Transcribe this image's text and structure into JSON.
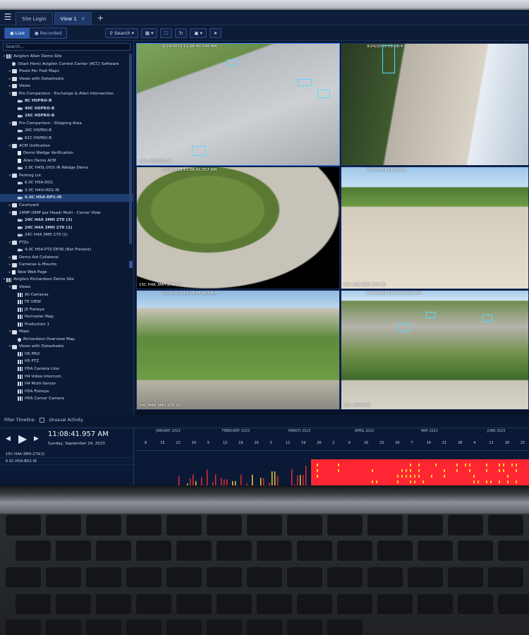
{
  "tabs": [
    {
      "label": "Site Login"
    },
    {
      "label": "View 1",
      "active": true
    }
  ],
  "toolbar": {
    "live_label": "Live",
    "recorded_label": "Recorded",
    "search_label": "Search"
  },
  "sidebar": {
    "search_placeholder": "Search...",
    "items": [
      {
        "label": "Avigilon Allen Demo Site",
        "indent": 0,
        "icon": "grid",
        "twisty": "▾"
      },
      {
        "label": "(Start Here) Avigilon Control Center (ACC) Software",
        "indent": 1,
        "icon": "pin"
      },
      {
        "label": "Pixels Per Foot Maps",
        "indent": 1,
        "icon": "folder",
        "twisty": "▸"
      },
      {
        "label": "Views with Datasheets",
        "indent": 1,
        "icon": "folder",
        "twisty": "▸"
      },
      {
        "label": "Views",
        "indent": 1,
        "icon": "folder",
        "twisty": "▸"
      },
      {
        "label": "Pro Comparison - Exchange & Allen Intersection",
        "indent": 1,
        "icon": "folder",
        "twisty": "▾"
      },
      {
        "label": "8C H5PRO-B",
        "indent": 2,
        "icon": "cam",
        "bold": true
      },
      {
        "label": "40C H5PRO-B",
        "indent": 2,
        "icon": "cam",
        "bold": true
      },
      {
        "label": "16C H5PRO-B",
        "indent": 2,
        "icon": "cam",
        "bold": true
      },
      {
        "label": "Pro Comparison - Shipping Area",
        "indent": 1,
        "icon": "folder",
        "twisty": "▾"
      },
      {
        "label": "26C H5PRO-B",
        "indent": 2,
        "icon": "cam"
      },
      {
        "label": "61C H5PRO-B",
        "indent": 2,
        "icon": "cam"
      },
      {
        "label": "ACM Unification",
        "indent": 1,
        "icon": "folder",
        "twisty": "▾"
      },
      {
        "label": "Demo Wedge Verification",
        "indent": 2,
        "icon": "page"
      },
      {
        "label": "Allen Demo ACM",
        "indent": 2,
        "icon": "page"
      },
      {
        "label": "2.0C H4SL-DO1-IR Wedge Demo",
        "indent": 2,
        "icon": "cam"
      },
      {
        "label": "Parking Lot",
        "indent": 1,
        "icon": "folder",
        "twisty": "▾"
      },
      {
        "label": "6.0C H5A-DO1",
        "indent": 2,
        "icon": "cam"
      },
      {
        "label": "3.0C H4VI-RD1-IR",
        "indent": 2,
        "icon": "cam"
      },
      {
        "label": "6.0C H5A-DP1-IR",
        "indent": 2,
        "icon": "cam",
        "bold": true,
        "selected": true
      },
      {
        "label": "Courtyard",
        "indent": 1,
        "icon": "folder",
        "twisty": "▸"
      },
      {
        "label": "24MP (6MP per Head) Multi - Corner View",
        "indent": 1,
        "icon": "folder",
        "twisty": "▾"
      },
      {
        "label": "24C H4A 3MH 270 (3)",
        "indent": 2,
        "icon": "cam",
        "bold": true
      },
      {
        "label": "24C H4A 3MH 270 (1)",
        "indent": 2,
        "icon": "cam",
        "bold": true
      },
      {
        "label": "24C H4A 3MH 270 (2)",
        "indent": 2,
        "icon": "cam"
      },
      {
        "label": "PTZs",
        "indent": 1,
        "icon": "folder",
        "twisty": "▾"
      },
      {
        "label": "4.0C H5A-PTZ-DP36 (Not Present)",
        "indent": 2,
        "icon": "cam"
      },
      {
        "label": "Demo Aid Collateral",
        "indent": 1,
        "icon": "folder",
        "twisty": "▸"
      },
      {
        "label": "Cameras & Mounts",
        "indent": 1,
        "icon": "folder",
        "twisty": "▸"
      },
      {
        "label": "New Web Page",
        "indent": 1,
        "icon": "page",
        "twisty": "▸"
      },
      {
        "label": "Avigilon Richardson Demo Site",
        "indent": 0,
        "icon": "grid",
        "twisty": "▾"
      },
      {
        "label": "Views",
        "indent": 1,
        "icon": "folder",
        "twisty": "▾"
      },
      {
        "label": "All Cameras",
        "indent": 2,
        "icon": "grid"
      },
      {
        "label": "FE VIEW",
        "indent": 2,
        "icon": "grid"
      },
      {
        "label": "J5 Fisheye",
        "indent": 2,
        "icon": "grid"
      },
      {
        "label": "Perimeter Map",
        "indent": 2,
        "icon": "grid"
      },
      {
        "label": "Production 1",
        "indent": 2,
        "icon": "grid"
      },
      {
        "label": "Maps",
        "indent": 1,
        "icon": "folder",
        "twisty": "▾"
      },
      {
        "label": "Richardson Overview Map",
        "indent": 2,
        "icon": "pin"
      },
      {
        "label": "Views with Datasheets",
        "indent": 1,
        "icon": "folder",
        "twisty": "▾"
      },
      {
        "label": "H5 PRO",
        "indent": 2,
        "icon": "grid"
      },
      {
        "label": "H5 PTZ",
        "indent": 2,
        "icon": "grid"
      },
      {
        "label": "H5A Camera Line",
        "indent": 2,
        "icon": "grid"
      },
      {
        "label": "H4 Video Intercom",
        "indent": 2,
        "icon": "grid"
      },
      {
        "label": "H4 Multi-Sensor",
        "indent": 2,
        "icon": "grid"
      },
      {
        "label": "H5A Fisheye",
        "indent": 2,
        "icon": "grid"
      },
      {
        "label": "H5A Corner Camera",
        "indent": 2,
        "icon": "grid"
      }
    ]
  },
  "tiles": [
    {
      "timestamp": "9/24/2023 11:08:40.348 AM",
      "label": "6.0C H5A-DP1-IR",
      "scene": "parking"
    },
    {
      "timestamp": "9/24/2023 11:08:4",
      "label": "",
      "scene": "sidewalk"
    },
    {
      "timestamp": "9/24/2023 11:08:41.357 AM",
      "label": "15C H4A 3MH 270 (1)",
      "scene": "grass"
    },
    {
      "timestamp": "9/24/2023 11:08:40.",
      "label": "24C H4A 3MH 270 (2)",
      "scene": "lot"
    },
    {
      "timestamp": "9/24/2023 11:06:04.063 AM",
      "label": "24C H4A 3MH 270 (3)",
      "scene": "building"
    },
    {
      "timestamp": "9/24/2023 11:08:42.323 AM",
      "label": "15C H5PRO-B",
      "scene": "road"
    }
  ],
  "filter": {
    "title": "Filter Timeline:",
    "option": "Unusual Activity"
  },
  "timeline": {
    "clock": "11:08:41.957 AM",
    "date": "Sunday, September 24, 2023",
    "rows": [
      "15C-H4A-3MH-270(2)",
      "6.0C-H5A-BO1-IR"
    ],
    "months": [
      "JANUARY 2023",
      "FEBRUARY 2023",
      "MARCH 2023",
      "APRIL 2023",
      "MAY 2023",
      "JUNE 2023"
    ],
    "days": [
      "8",
      "15",
      "22",
      "29",
      "5",
      "12",
      "19",
      "26",
      "5",
      "12",
      "19",
      "26",
      "2",
      "9",
      "16",
      "23",
      "30",
      "7",
      "14",
      "21",
      "28",
      "4",
      "11",
      "18",
      "25"
    ],
    "colors": {
      "motion": "#ff2633",
      "event": "#ffd12e"
    }
  }
}
